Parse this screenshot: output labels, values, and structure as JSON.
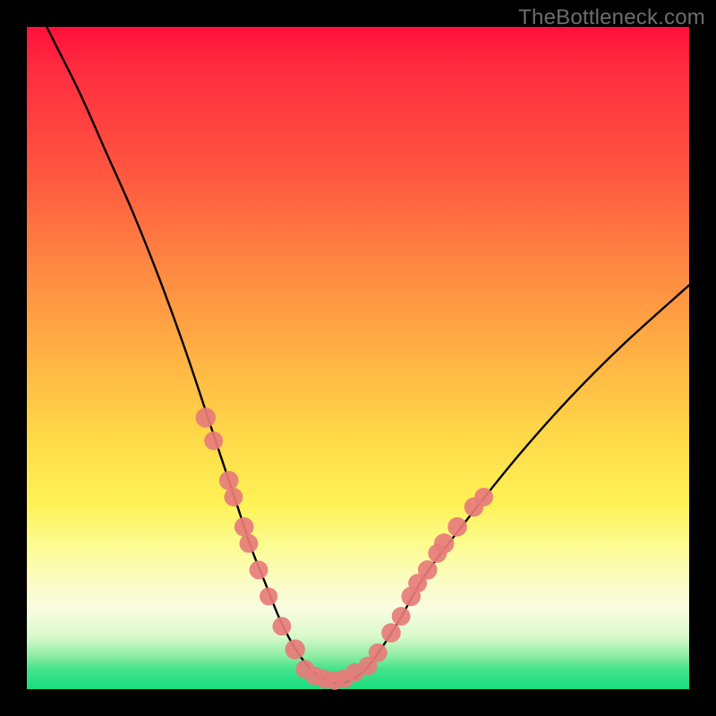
{
  "watermark": "TheBottleneck.com",
  "chart_data": {
    "type": "line",
    "title": "",
    "xlabel": "",
    "ylabel": "",
    "xlim": [
      0,
      100
    ],
    "ylim": [
      0,
      100
    ],
    "grid": false,
    "series": [
      {
        "name": "bottleneck-curve",
        "x": [
          0,
          4,
          8,
          12,
          16,
          20,
          24,
          28,
          32,
          34,
          36,
          38,
          40,
          42,
          44,
          46,
          48,
          50,
          52,
          56,
          60,
          66,
          74,
          82,
          90,
          100
        ],
        "y": [
          106,
          98,
          90,
          81,
          72,
          62,
          51,
          39,
          27,
          21,
          16,
          11,
          7,
          4,
          2,
          1,
          1,
          2,
          4,
          10,
          17,
          25,
          35,
          44,
          52,
          61
        ]
      }
    ],
    "markers": {
      "name": "highlight-dots",
      "points": [
        {
          "x": 27.0,
          "y": 41.0,
          "r": 1.4
        },
        {
          "x": 28.2,
          "y": 37.5,
          "r": 1.2
        },
        {
          "x": 30.5,
          "y": 31.5,
          "r": 1.3
        },
        {
          "x": 31.2,
          "y": 29.0,
          "r": 1.2
        },
        {
          "x": 32.8,
          "y": 24.5,
          "r": 1.3
        },
        {
          "x": 33.5,
          "y": 22.0,
          "r": 1.2
        },
        {
          "x": 35.0,
          "y": 18.0,
          "r": 1.2
        },
        {
          "x": 36.5,
          "y": 14.0,
          "r": 1.1
        },
        {
          "x": 38.5,
          "y": 9.5,
          "r": 1.2
        },
        {
          "x": 40.5,
          "y": 6.0,
          "r": 1.4
        },
        {
          "x": 42.0,
          "y": 3.0,
          "r": 1.2
        },
        {
          "x": 43.5,
          "y": 2.0,
          "r": 1.2
        },
        {
          "x": 45.0,
          "y": 1.5,
          "r": 1.2
        },
        {
          "x": 46.5,
          "y": 1.3,
          "r": 1.2
        },
        {
          "x": 48.0,
          "y": 1.6,
          "r": 1.2
        },
        {
          "x": 49.5,
          "y": 2.5,
          "r": 1.2
        },
        {
          "x": 51.5,
          "y": 3.5,
          "r": 1.2
        },
        {
          "x": 53.0,
          "y": 5.5,
          "r": 1.2
        },
        {
          "x": 55.0,
          "y": 8.5,
          "r": 1.3
        },
        {
          "x": 56.5,
          "y": 11.0,
          "r": 1.2
        },
        {
          "x": 58.0,
          "y": 14.0,
          "r": 1.3
        },
        {
          "x": 59.0,
          "y": 16.0,
          "r": 1.2
        },
        {
          "x": 60.5,
          "y": 18.0,
          "r": 1.3
        },
        {
          "x": 62.0,
          "y": 20.5,
          "r": 1.2
        },
        {
          "x": 63.0,
          "y": 22.0,
          "r": 1.4
        },
        {
          "x": 65.0,
          "y": 24.5,
          "r": 1.3
        },
        {
          "x": 67.5,
          "y": 27.5,
          "r": 1.3
        },
        {
          "x": 69.0,
          "y": 29.0,
          "r": 1.2
        }
      ]
    }
  }
}
